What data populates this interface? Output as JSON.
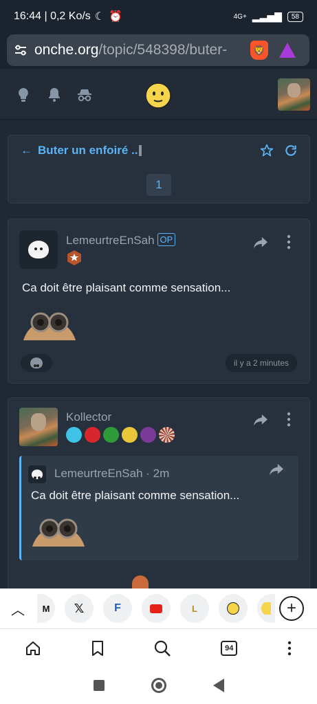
{
  "status_bar": {
    "time_speed": "16:44 | 0,2 Ko/s",
    "network": "4G+",
    "battery": "58"
  },
  "browser": {
    "url_domain": "onche.org",
    "url_path": "/topic/548398/buter-"
  },
  "topic": {
    "back_arrow": "←",
    "title": "Buter un enfoiré ..",
    "page_number": "1"
  },
  "posts": [
    {
      "author": "LemeurtreEnSah",
      "op_badge": "OP",
      "message": "Ca doit être plaisant comme sensation...",
      "timestamp": "il y a 2 minutes"
    },
    {
      "author": "Kollector",
      "quote": {
        "author": "LemeurtreEnSah",
        "separator": "·",
        "time": "2m",
        "message": "Ca doit être plaisant comme sensation..."
      }
    }
  ],
  "shortcuts": {
    "tab_count": "94"
  },
  "colors": {
    "accent": "#5db4f4",
    "background": "#1f2833",
    "card": "#27303d"
  }
}
